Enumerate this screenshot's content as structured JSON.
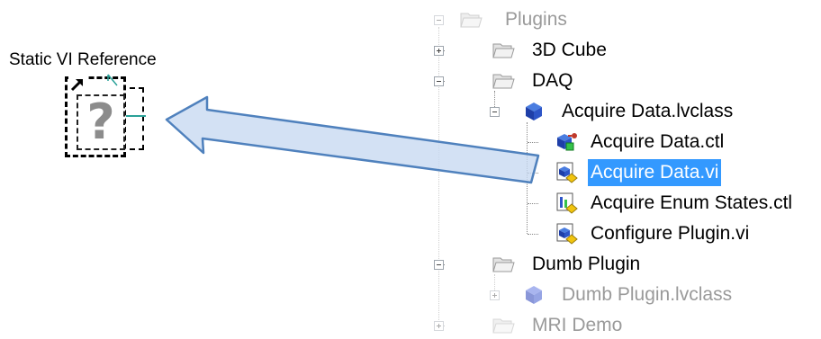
{
  "static_vi_reference": {
    "label": "Static VI Reference",
    "icon": "question-mark-icon",
    "glyph": "?"
  },
  "tree": {
    "items": [
      {
        "label": "Plugins",
        "icon": "folder-icon",
        "expander": "minus",
        "state": "faded"
      },
      {
        "label": "3D Cube",
        "icon": "folder-icon",
        "expander": "plus",
        "state": "normal"
      },
      {
        "label": "DAQ",
        "icon": "folder-icon",
        "expander": "minus",
        "state": "normal"
      },
      {
        "label": "Acquire Data.lvclass",
        "icon": "lvclass-cube-icon",
        "expander": "minus",
        "state": "normal"
      },
      {
        "label": "Acquire Data.ctl",
        "icon": "class-private-data-icon",
        "state": "normal"
      },
      {
        "label": "Acquire Data.vi",
        "icon": "vi-icon",
        "state": "selected"
      },
      {
        "label": "Acquire Enum States.ctl",
        "icon": "ctl-icon",
        "state": "normal"
      },
      {
        "label": "Configure Plugin.vi",
        "icon": "vi-icon",
        "state": "normal"
      },
      {
        "label": "Dumb Plugin",
        "icon": "folder-icon",
        "expander": "minus",
        "state": "normal"
      },
      {
        "label": "Dumb Plugin.lvclass",
        "icon": "lvclass-cube-icon",
        "expander": "plus",
        "state": "faded"
      },
      {
        "label": "MRI Demo",
        "icon": "folder-icon",
        "expander": "plus",
        "state": "faded"
      }
    ]
  },
  "colors": {
    "selection": "#3399ff",
    "arrow_fill": "#c6d9f1",
    "arrow_stroke": "#4f81bd",
    "wire": "#2aa198"
  }
}
